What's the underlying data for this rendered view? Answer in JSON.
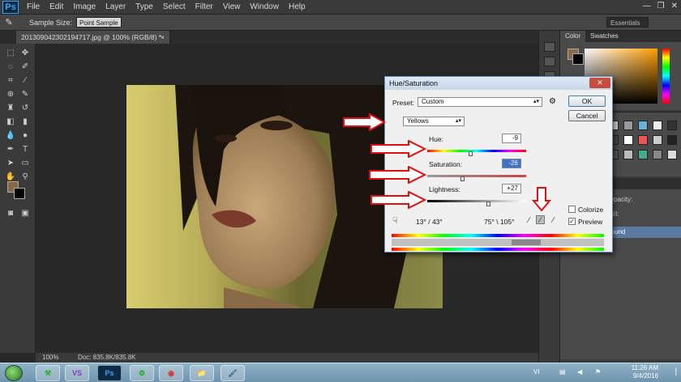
{
  "app": {
    "logo": "Ps",
    "menu": [
      "File",
      "Edit",
      "Image",
      "Layer",
      "Type",
      "Select",
      "Filter",
      "View",
      "Window",
      "Help"
    ],
    "window_controls": [
      "—",
      "❐",
      "✕"
    ]
  },
  "options_bar": {
    "sample_size_label": "Sample Size:",
    "sample_size_value": "Point Sample",
    "workspace": "Essentials"
  },
  "document": {
    "tab_title": "20130904230219471​7.jpg @ 100% (RGB/8) *",
    "tab_close": "×",
    "zoom": "100%",
    "doc_info": "Doc: 835.8K/835.8K"
  },
  "panels": {
    "color_tab": "Color",
    "swatches_tab": "Swatches",
    "layers_tab": "Paths",
    "opacity_label": "Opacity:",
    "fill_label": "Fill:",
    "layer_name": "round"
  },
  "dialog": {
    "title": "Hue/Saturation",
    "close": "✕",
    "preset_label": "Preset:",
    "preset_value": "Custom",
    "channel_value": "Yellows",
    "ok": "OK",
    "cancel": "Cancel",
    "hue_label": "Hue:",
    "hue_value": "-9",
    "saturation_label": "Saturation:",
    "saturation_value": "-26",
    "lightness_label": "Lightness:",
    "lightness_value": "+27",
    "range_left": "13° / 43°",
    "range_right": "75° \\ 105°",
    "colorize_label": "Colorize",
    "preview_label": "Preview",
    "colorize_checked": false,
    "preview_checked": true,
    "check_mark": "✓"
  },
  "taskbar": {
    "apps": [
      "VS",
      "Ps",
      "⚙",
      "◉",
      "📁",
      "🖌"
    ],
    "time": "11:26 AM",
    "date": "9/4/2016",
    "lang": "VI"
  }
}
